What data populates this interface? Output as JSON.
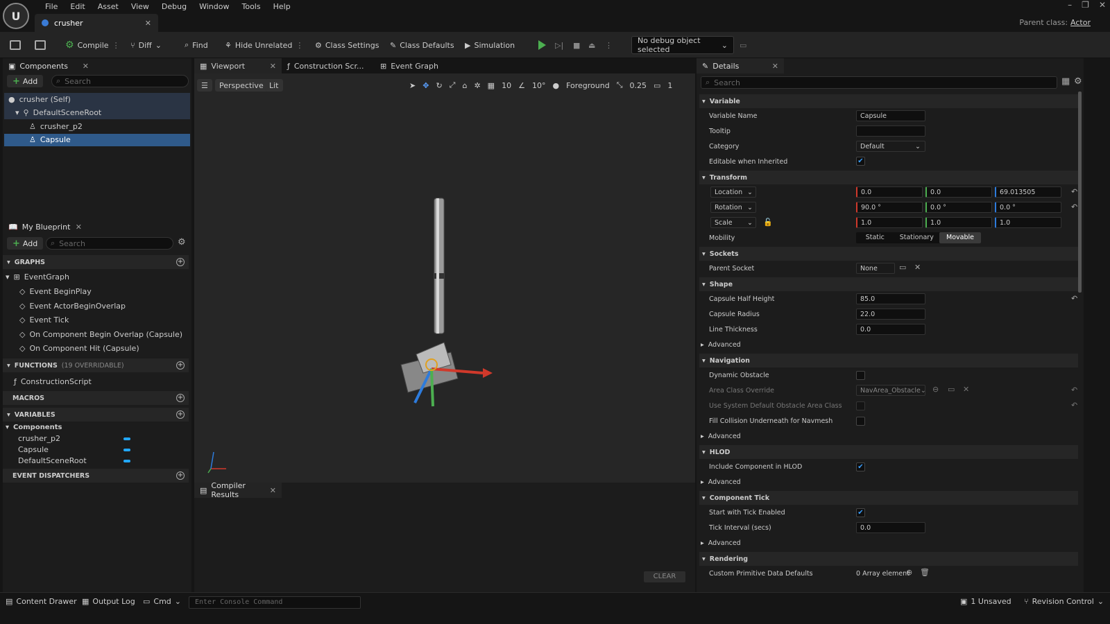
{
  "app": {
    "logo_text": "U"
  },
  "menu": [
    "File",
    "Edit",
    "Asset",
    "View",
    "Debug",
    "Window",
    "Tools",
    "Help"
  ],
  "document_tab": {
    "label": "crusher"
  },
  "window": {
    "minimize": "–",
    "restore": "❐",
    "close": "✕"
  },
  "parent_class": {
    "label": "Parent class:",
    "value": "Actor"
  },
  "toolbar": {
    "compile": "Compile",
    "diff": "Diff",
    "find": "Find",
    "hide_unrelated": "Hide Unrelated",
    "class_settings": "Class Settings",
    "class_defaults": "Class Defaults",
    "simulation": "Simulation",
    "debug_object": "No debug object selected"
  },
  "components_panel": {
    "tab": "Components",
    "add": "Add",
    "search_placeholder": "Search",
    "tree": [
      "crusher (Self)",
      "DefaultSceneRoot",
      "crusher_p2",
      "Capsule"
    ]
  },
  "my_blueprint": {
    "tab": "My Blueprint",
    "add": "Add",
    "search_placeholder": "Search",
    "graphs_header": "GRAPHS",
    "event_graph": "EventGraph",
    "events": [
      "Event BeginPlay",
      "Event ActorBeginOverlap",
      "Event Tick",
      "On Component Begin Overlap (Capsule)",
      "On Component Hit (Capsule)"
    ],
    "functions_header": "FUNCTIONS",
    "functions_sub": "(19 OVERRIDABLE)",
    "construction_script": "ConstructionScript",
    "macros_header": "MACROS",
    "variables_header": "VARIABLES",
    "components_group": "Components",
    "variables": [
      "crusher_p2",
      "Capsule",
      "DefaultSceneRoot"
    ],
    "dispatchers_header": "EVENT DISPATCHERS",
    "variable_color": "#22a8ff"
  },
  "viewport": {
    "tabs": [
      "Viewport",
      "Construction Scr...",
      "Event Graph"
    ],
    "perspective": "Perspective",
    "lit": "Lit",
    "grid": "10",
    "angle": "10°",
    "foreground": "Foreground",
    "scale": "0.25",
    "camera": "1"
  },
  "compiler": {
    "tab": "Compiler Results",
    "clear": "CLEAR"
  },
  "details": {
    "tab": "Details",
    "search_placeholder": "Search",
    "variable": {
      "header": "Variable",
      "name_label": "Variable Name",
      "name": "Capsule",
      "tooltip_label": "Tooltip",
      "category_label": "Category",
      "category": "Default",
      "editable_label": "Editable when Inherited"
    },
    "transform": {
      "header": "Transform",
      "location": "Location",
      "rotation": "Rotation",
      "scale": "Scale",
      "loc": [
        "0.0",
        "0.0",
        "69.013505"
      ],
      "rot": [
        "90.0 °",
        "0.0 °",
        "0.0 °"
      ],
      "scl": [
        "1.0",
        "1.0",
        "1.0"
      ],
      "mobility": "Mobility",
      "mobility_opts": [
        "Static",
        "Stationary",
        "Movable"
      ]
    },
    "sockets": {
      "header": "Sockets",
      "parent_label": "Parent Socket",
      "parent": "None"
    },
    "shape": {
      "header": "Shape",
      "half_height_label": "Capsule Half Height",
      "half_height": "85.0",
      "radius_label": "Capsule Radius",
      "radius": "22.0",
      "thickness_label": "Line Thickness",
      "thickness": "0.0"
    },
    "advanced": "Advanced",
    "navigation": {
      "header": "Navigation",
      "dyn": "Dynamic Obstacle",
      "area": "Area Class Override",
      "area_value": "NavArea_Obstacle",
      "use_sys": "Use System Default Obstacle Area Class",
      "fill": "Fill Collision Underneath for Navmesh"
    },
    "hlod": {
      "header": "HLOD",
      "include": "Include Component in HLOD"
    },
    "tick": {
      "header": "Component Tick",
      "start": "Start with Tick Enabled",
      "interval_label": "Tick Interval (secs)",
      "interval": "0.0"
    },
    "rendering": {
      "header": "Rendering",
      "custom": "Custom Primitive Data Defaults",
      "custom_value": "0 Array element"
    }
  },
  "statusbar": {
    "content_drawer": "Content Drawer",
    "output_log": "Output Log",
    "cmd": "Cmd",
    "console_placeholder": "Enter Console Command",
    "unsaved": "1 Unsaved",
    "revision": "Revision Control"
  },
  "colors": {
    "accent": "#2f5a8a",
    "x_axis": "#d0392b",
    "y_axis": "#4caf50",
    "z_axis": "#2d7bdc"
  }
}
